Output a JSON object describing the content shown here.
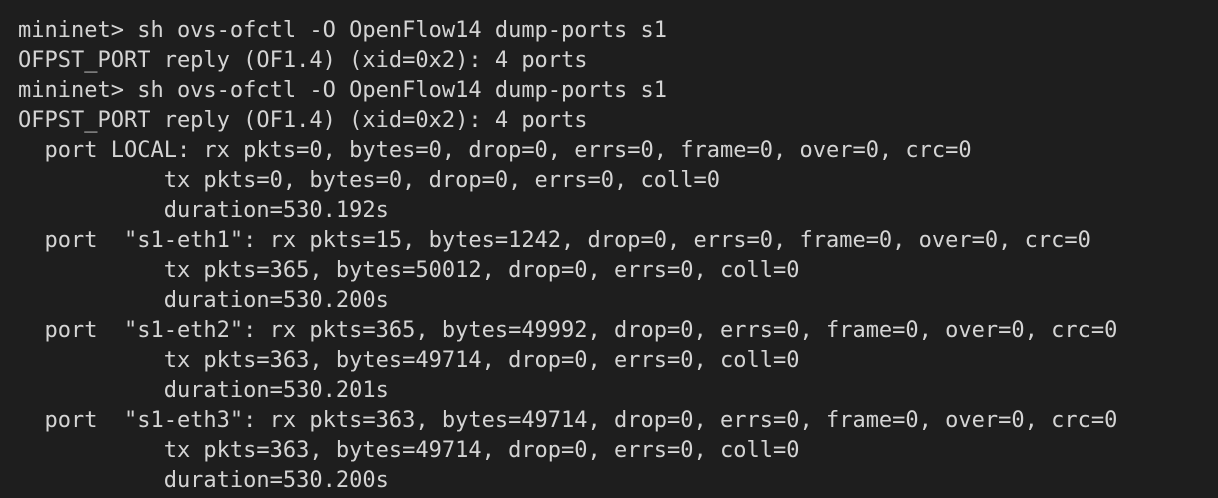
{
  "terminal": {
    "lines": [
      "mininet> sh ovs-ofctl -O OpenFlow14 dump-ports s1",
      "OFPST_PORT reply (OF1.4) (xid=0x2): 4 ports",
      "mininet> sh ovs-ofctl -O OpenFlow14 dump-ports s1",
      "OFPST_PORT reply (OF1.4) (xid=0x2): 4 ports",
      "  port LOCAL: rx pkts=0, bytes=0, drop=0, errs=0, frame=0, over=0, crc=0",
      "           tx pkts=0, bytes=0, drop=0, errs=0, coll=0",
      "           duration=530.192s",
      "  port  \"s1-eth1\": rx pkts=15, bytes=1242, drop=0, errs=0, frame=0, over=0, crc=0",
      "           tx pkts=365, bytes=50012, drop=0, errs=0, coll=0",
      "           duration=530.200s",
      "  port  \"s1-eth2\": rx pkts=365, bytes=49992, drop=0, errs=0, frame=0, over=0, crc=0",
      "           tx pkts=363, bytes=49714, drop=0, errs=0, coll=0",
      "           duration=530.201s",
      "  port  \"s1-eth3\": rx pkts=363, bytes=49714, drop=0, errs=0, frame=0, over=0, crc=0",
      "           tx pkts=363, bytes=49714, drop=0, errs=0, coll=0",
      "           duration=530.200s"
    ]
  },
  "colors": {
    "background": "#1e1e1e",
    "text": "#d4d4d4"
  }
}
